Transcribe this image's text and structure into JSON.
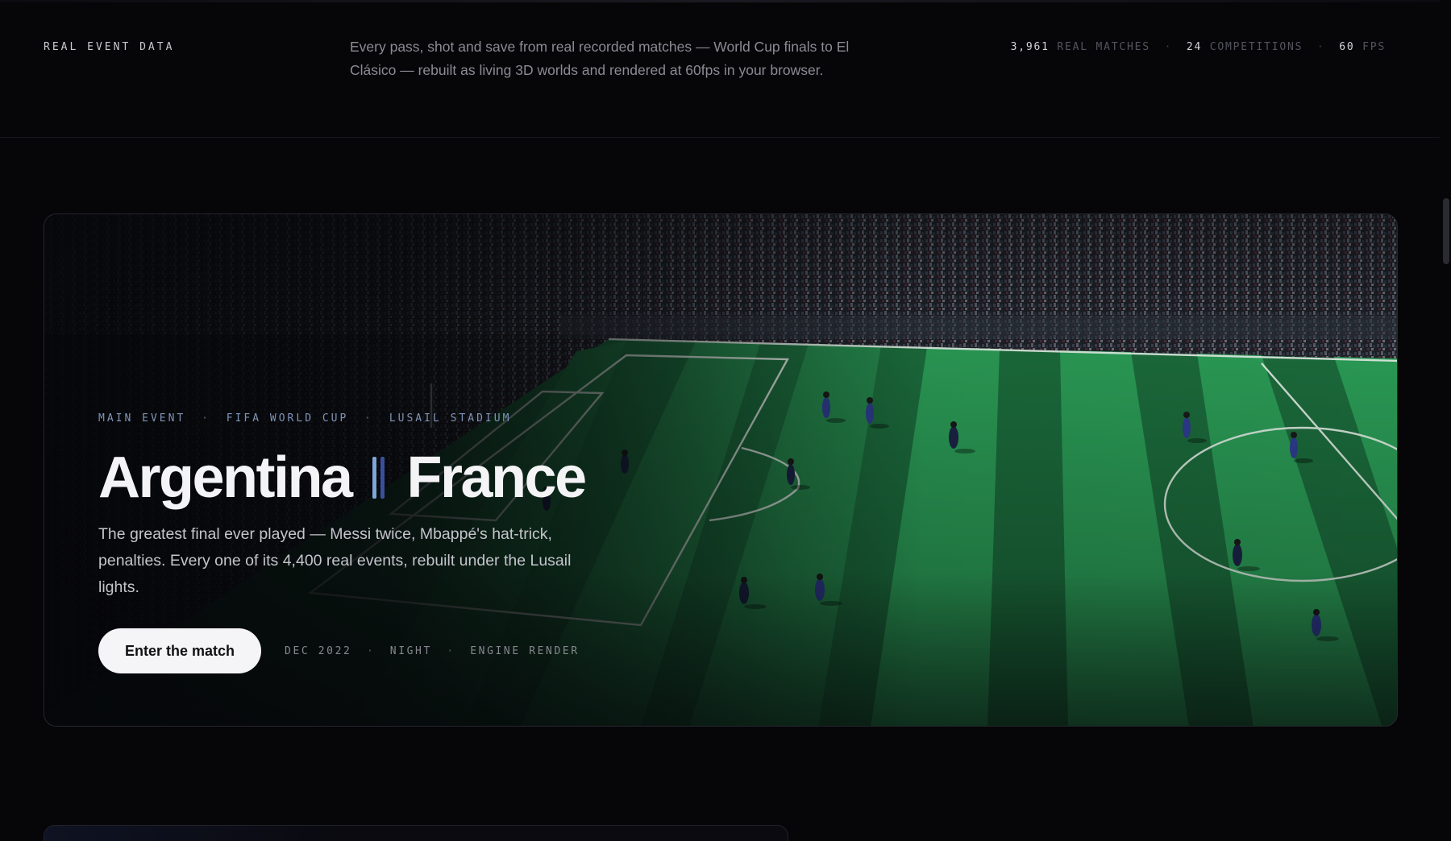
{
  "intro": {
    "eyebrow": "REAL EVENT DATA",
    "description": "Every pass, shot and save from real recorded matches — World Cup finals to El Clásico — rebuilt as living 3D worlds and rendered at 60fps in your browser.",
    "stats": [
      {
        "value": "3,961",
        "label": "REAL MATCHES"
      },
      {
        "value": "24",
        "label": "COMPETITIONS"
      },
      {
        "value": "60",
        "label": "FPS"
      }
    ],
    "separator": "·"
  },
  "hero": {
    "eyebrow": [
      "MAIN EVENT",
      "FIFA WORLD CUP",
      "LUSAIL STADIUM"
    ],
    "home_team": "Argentina",
    "away_team": "France",
    "vs_colors": [
      "#7fa6d8",
      "#3c4f9a"
    ],
    "description": "The greatest final ever played — Messi twice, Mbappé's hat-trick, penalties. Every one of its 4,400 real events, rebuilt under the Lusail lights.",
    "cta_label": "Enter the match",
    "meta": [
      "DEC 2022",
      "NIGHT",
      "ENGINE RENDER"
    ],
    "image": "stadium-pitch-render",
    "colors": {
      "pitch_dark": "#1a6b3a",
      "pitch_light": "#2a9a55",
      "kit_home": "#2e3d8f",
      "kit_away": "#1b2447"
    }
  }
}
